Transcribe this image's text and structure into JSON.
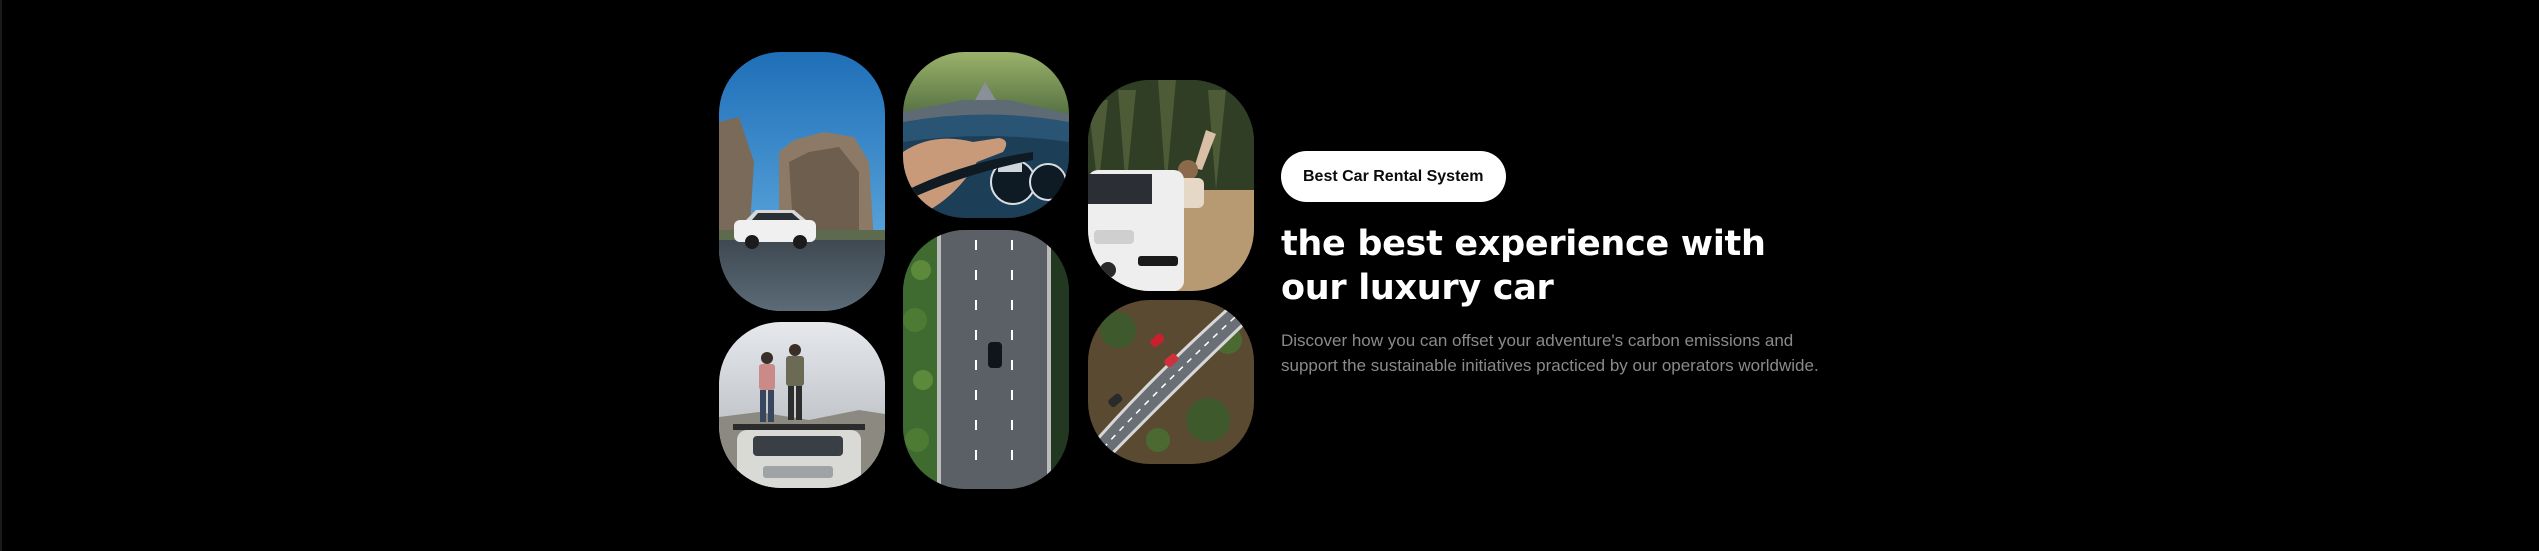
{
  "badge": {
    "label": "Best Car Rental System"
  },
  "hero": {
    "headline": "the best experience with our luxury car",
    "description": "Discover how you can offset your adventure's carbon emissions and support the sustainable initiatives practiced by our operators worldwide."
  },
  "gallery": {
    "images": [
      {
        "name": "suv-parked-by-rock-cliffs-photo"
      },
      {
        "name": "two-people-standing-on-car-roof-photo"
      },
      {
        "name": "hand-on-steering-wheel-photo"
      },
      {
        "name": "aerial-highway-with-car-photo"
      },
      {
        "name": "woman-waving-from-car-window-photo"
      },
      {
        "name": "aerial-curved-road-with-cars-photo"
      }
    ]
  },
  "colors": {
    "background": "#000000",
    "badge_background": "#ffffff",
    "badge_text": "#0b0b0b",
    "headline": "#ffffff",
    "description": "#8a8a8a"
  }
}
